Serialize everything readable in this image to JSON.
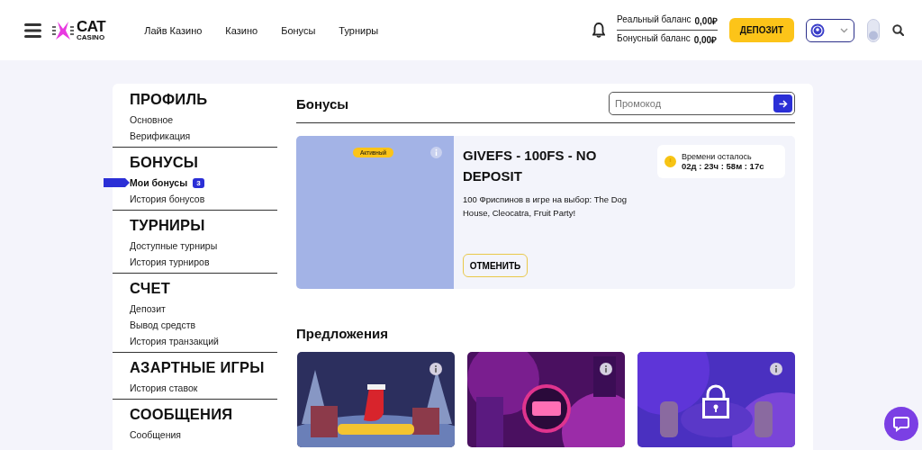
{
  "header": {
    "logo": {
      "line1": "CAT",
      "line2": "CASINO"
    },
    "nav": [
      {
        "label": "Лайв Казино"
      },
      {
        "label": "Казино"
      },
      {
        "label": "Бонусы"
      },
      {
        "label": "Турниры"
      }
    ],
    "balances": [
      {
        "label": "Реальный баланс",
        "amount": "0,00₽"
      },
      {
        "label": "Бонусный баланс",
        "amount": "0,00₽"
      }
    ],
    "deposit_button": "ДЕПОЗИТ"
  },
  "sidebar": {
    "sections": [
      {
        "title": "ПРОФИЛЬ",
        "items": [
          {
            "label": "Основное",
            "selected": false
          },
          {
            "label": "Верификация",
            "selected": false
          }
        ]
      },
      {
        "title": "БОНУСЫ",
        "items": [
          {
            "label": "Мои бонусы",
            "selected": true,
            "badge": "3"
          },
          {
            "label": "История бонусов",
            "selected": false
          }
        ]
      },
      {
        "title": "ТУРНИРЫ",
        "items": [
          {
            "label": "Доступные турниры",
            "selected": false
          },
          {
            "label": "История турниров",
            "selected": false
          }
        ]
      },
      {
        "title": "СЧЕТ",
        "items": [
          {
            "label": "Депозит",
            "selected": false
          },
          {
            "label": "Вывод средств",
            "selected": false
          },
          {
            "label": "История транзакций",
            "selected": false
          }
        ]
      },
      {
        "title": "АЗАРТНЫЕ ИГРЫ",
        "items": [
          {
            "label": "История ставок",
            "selected": false
          }
        ]
      },
      {
        "title": "СООБЩЕНИЯ",
        "items": [
          {
            "label": "Сообщения",
            "selected": false
          }
        ]
      }
    ]
  },
  "bonuses": {
    "title": "Бонусы",
    "promo_placeholder": "Промокод",
    "active_bonus": {
      "status": "Активный",
      "title": "GIVEFS - 100FS - NO DEPOSIT",
      "description": "100 Фриспинов в игре на выбор: The Dog House, Cleocatra, Fruit Party!",
      "timer_label": "Времени осталось",
      "timer": "02д : 23ч : 58м : 17с",
      "cancel_button": "ОТМЕНИТЬ"
    }
  },
  "offers": {
    "title": "Предложения",
    "cards": [
      {
        "kind": "picture",
        "locked": false
      },
      {
        "kind": "picture",
        "locked": false
      },
      {
        "kind": "picture",
        "locked": true
      }
    ]
  }
}
